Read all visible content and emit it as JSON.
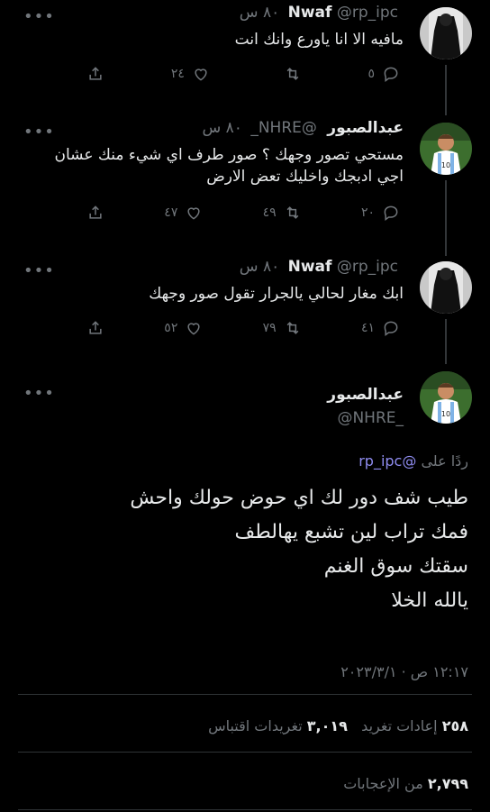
{
  "tweets": [
    {
      "name": "Nwaf",
      "handle": "@rp_ipc",
      "time": "٨٠ س",
      "text": "مافيه الا انا ياورع وانك انت",
      "replies": "٥",
      "retweets": "",
      "likes": "٢٤",
      "avatar": "dark-figure"
    },
    {
      "name": "عبدالصبور",
      "handle": "@NHRE_",
      "time": "٨٠ س",
      "text": "مستحي تصور وجهك ؟ صور طرف اي شيء منك عشان اجي ادبجك واخليك تعض الارض",
      "replies": "٢٠",
      "retweets": "٤٩",
      "likes": "٤٧",
      "avatar": "player"
    },
    {
      "name": "Nwaf",
      "handle": "@rp_ipc",
      "time": "٨٠ س",
      "text": "ابك مغار لحالي يالجرار تقول صور وجهك",
      "replies": "٤١",
      "retweets": "٧٩",
      "likes": "٥٢",
      "avatar": "dark-figure"
    }
  ],
  "main": {
    "name": "عبدالصبور",
    "handle": "@NHRE_",
    "replying_prefix": "ردًا على",
    "replying_mention": "@rp_ipc",
    "lines": [
      "طيب شف دور لك اي حوض حولك واحش",
      "فمك تراب لين تشبع يهالطف",
      "سقتك سوق الغنم",
      "يالله الخلا"
    ],
    "timestamp": "١٢:١٧ ص · ٢٠٢٣/٣/١",
    "retweets_count": "٢٥٨",
    "retweets_label": "إعادات تغريد",
    "quotes_count": "٣,٠١٩",
    "quotes_label": "تغريدات اقتباس",
    "likes_count": "٢,٧٩٩",
    "likes_label": "من الإعجابات"
  },
  "colors": {
    "background": "#000000",
    "text": "#e7e9ea",
    "muted": "#71767b",
    "mention": "#8f8cf0"
  },
  "icons": [
    "reply-icon",
    "retweet-icon",
    "like-icon",
    "share-icon",
    "more-icon"
  ]
}
